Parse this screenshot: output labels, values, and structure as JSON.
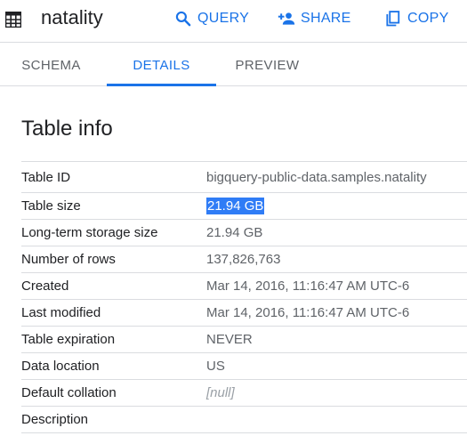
{
  "header": {
    "title": "natality",
    "actions": {
      "query": "QUERY",
      "share": "SHARE",
      "copy": "COPY"
    },
    "accent_color": "#1a73e8"
  },
  "tabs": [
    {
      "label": "SCHEMA",
      "active": false
    },
    {
      "label": "DETAILS",
      "active": true
    },
    {
      "label": "PREVIEW",
      "active": false
    }
  ],
  "table_info": {
    "title": "Table info",
    "rows": [
      {
        "label": "Table ID",
        "value": "bigquery-public-data.samples.natality"
      },
      {
        "label": "Table size",
        "value": "21.94 GB",
        "selected": true
      },
      {
        "label": "Long-term storage size",
        "value": "21.94 GB"
      },
      {
        "label": "Number of rows",
        "value": "137,826,763"
      },
      {
        "label": "Created",
        "value": "Mar 14, 2016, 11:16:47 AM UTC-6"
      },
      {
        "label": "Last modified",
        "value": "Mar 14, 2016, 11:16:47 AM UTC-6"
      },
      {
        "label": "Table expiration",
        "value": "NEVER"
      },
      {
        "label": "Data location",
        "value": "US"
      },
      {
        "label": "Default collation",
        "value": "[null]"
      },
      {
        "label": "Description",
        "value": ""
      }
    ]
  },
  "icons": {
    "table": "table-icon",
    "query": "search-icon",
    "share": "add-person-icon",
    "copy": "copy-icon"
  }
}
